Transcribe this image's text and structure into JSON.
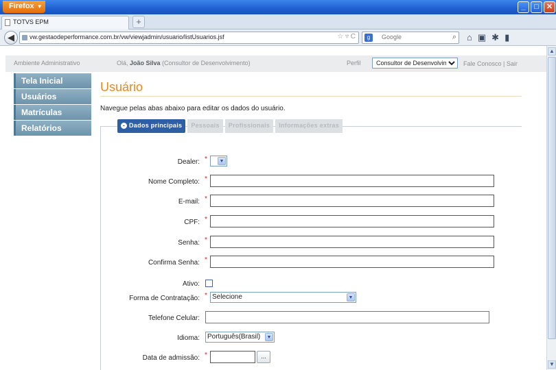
{
  "browser": {
    "firefox_button": "Firefox",
    "tab_title": "TOTVS EPM",
    "new_tab": "+",
    "url": "vw.gestaodeperformance.com.br/vw/viewjadmin/usuario/listUsuarios.jsf",
    "search_placeholder": "Google",
    "search_engine_letter": "g"
  },
  "header": {
    "environment": "Ambiente Administrativo",
    "greeting_prefix": "Olá, ",
    "user_name": "João Silva",
    "user_role_suffix": " (Consultor de Desenvolvimento)",
    "perfil_label": "Perfil",
    "perfil_value": "Consultor de Desenvolvimento",
    "links": "Fale Conosco  |  Sair"
  },
  "sidebar": {
    "items": [
      {
        "label": "Tela Inicial"
      },
      {
        "label": "Usuários"
      },
      {
        "label": "Matrículas"
      },
      {
        "label": "Relatórios"
      }
    ]
  },
  "main": {
    "title": "Usuário",
    "intro": "Navegue pelas abas abaixo para editar os dados do usuário.",
    "tabs": [
      {
        "label": "Dados principais",
        "active": true
      },
      {
        "label": "Pessoais",
        "active": false
      },
      {
        "label": "Profissionais",
        "active": false
      },
      {
        "label": "Informações extras",
        "active": false
      }
    ]
  },
  "form": {
    "dealer_label": "Dealer:",
    "dealer_value": "",
    "nome_label": "Nome Completo:",
    "email_label": "E-mail:",
    "cpf_label": "CPF:",
    "senha_label": "Senha:",
    "confirma_label": "Confirma Senha:",
    "ativo_label": "Ativo:",
    "contratacao_label": "Forma de Contratação:",
    "contratacao_value": "Selecione",
    "telefone_label": "Telefone Celular:",
    "idioma_label": "Idioma:",
    "idioma_value": "Português(Brasil)",
    "admissao_label": "Data de admissão:",
    "admissao_button": "...",
    "required_mark": "*"
  },
  "colors": {
    "title": "#e68a1e",
    "active_tab": "#2e5fa5",
    "sidebar": "#7fa2b8",
    "required": "#dd2222"
  }
}
